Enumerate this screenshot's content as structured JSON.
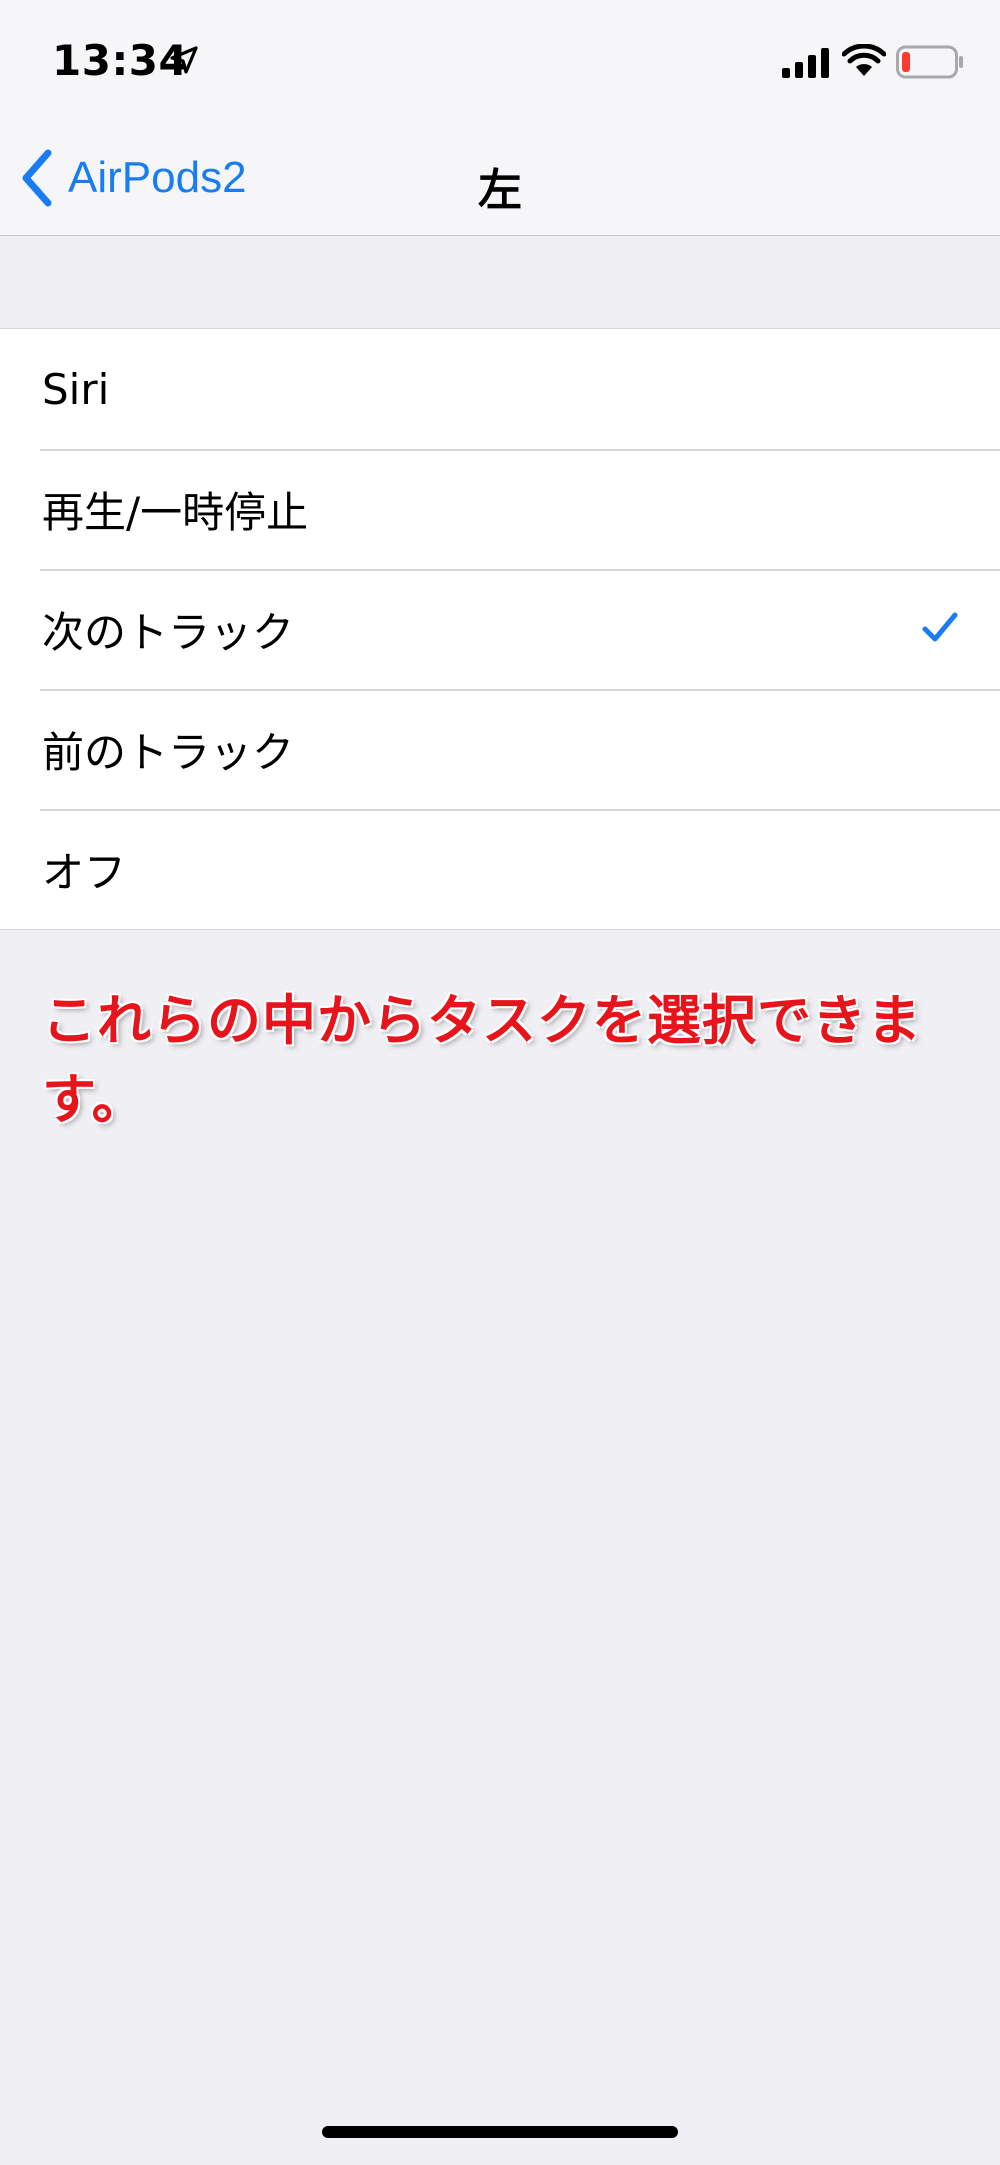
{
  "status_bar": {
    "time": "13:34",
    "location_icon": "location-arrow-icon",
    "signal_icon": "cellular-signal-icon",
    "wifi_icon": "wifi-icon",
    "battery_icon": "battery-low-icon",
    "battery_color": "#ff3b30"
  },
  "nav": {
    "back_label": "AirPods2",
    "title": "左",
    "accent_color": "#1a7cf2"
  },
  "options": [
    {
      "label": "Siri",
      "selected": false
    },
    {
      "label": "再生/一時停止",
      "selected": false
    },
    {
      "label": "次のトラック",
      "selected": true
    },
    {
      "label": "前のトラック",
      "selected": false
    },
    {
      "label": "オフ",
      "selected": false
    }
  ],
  "annotation": {
    "text": "これらの中からタスクを選択できます。",
    "color": "#e8141c"
  }
}
